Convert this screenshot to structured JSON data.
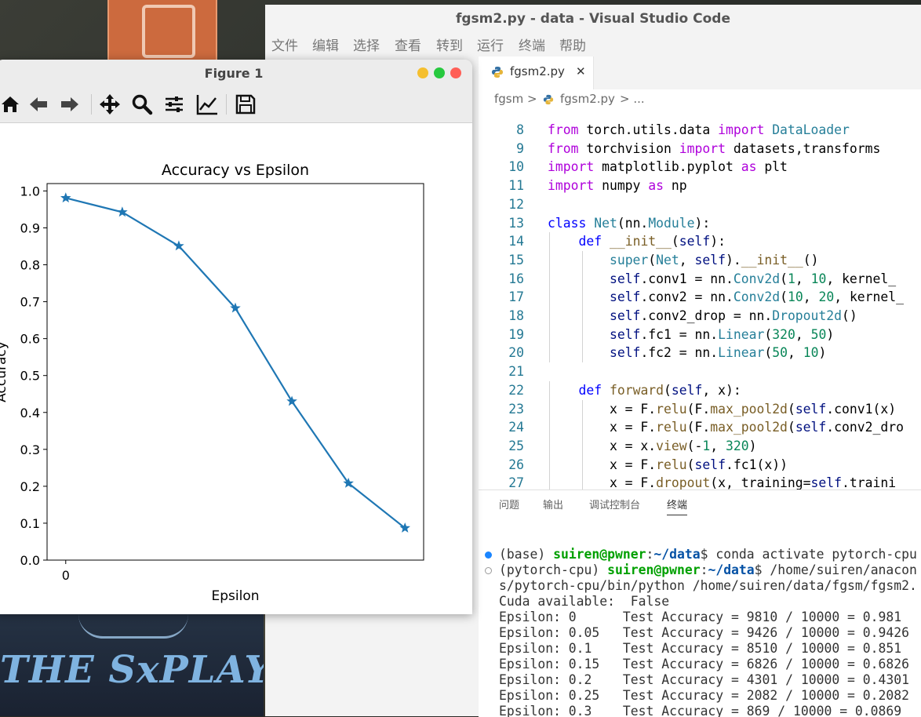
{
  "vscode": {
    "title": "fgsm2.py - data - Visual Studio Code",
    "menu": [
      "文件",
      "编辑",
      "选择",
      "查看",
      "转到",
      "运行",
      "终端",
      "帮助"
    ],
    "tab_label": "fgsm2.py",
    "tab_close": "✕",
    "breadcrumb": [
      "fgsm",
      ">",
      "fgsm2.py",
      "> ..."
    ],
    "panel_tabs": [
      "问题",
      "输出",
      "调试控制台",
      "终端"
    ]
  },
  "code_lines": [
    {
      "n": "8",
      "segs": [
        [
          "kw",
          "from "
        ],
        [
          "tx",
          "torch.utils.data "
        ],
        [
          "kw",
          "import "
        ],
        [
          "cl",
          "DataLoader"
        ]
      ]
    },
    {
      "n": "9",
      "segs": [
        [
          "kw",
          "from "
        ],
        [
          "tx",
          "torchvision "
        ],
        [
          "kw",
          "import "
        ],
        [
          "tx",
          "datasets,transforms"
        ]
      ]
    },
    {
      "n": "10",
      "segs": [
        [
          "kw",
          "import "
        ],
        [
          "tx",
          "matplotlib.pyplot "
        ],
        [
          "kw",
          "as "
        ],
        [
          "tx",
          "plt"
        ]
      ]
    },
    {
      "n": "11",
      "segs": [
        [
          "kw",
          "import "
        ],
        [
          "tx",
          "numpy "
        ],
        [
          "kw",
          "as "
        ],
        [
          "tx",
          "np"
        ]
      ]
    },
    {
      "n": "12",
      "segs": []
    },
    {
      "n": "13",
      "segs": [
        [
          "kb",
          "class "
        ],
        [
          "cl",
          "Net"
        ],
        [
          "tx",
          "(nn."
        ],
        [
          "cl",
          "Module"
        ],
        [
          "tx",
          "):"
        ]
      ]
    },
    {
      "n": "14",
      "segs": [
        [
          "tx",
          "    "
        ],
        [
          "kb",
          "def "
        ],
        [
          "fn",
          "__init__"
        ],
        [
          "tx",
          "("
        ],
        [
          "sf",
          "self"
        ],
        [
          "tx",
          "):"
        ]
      ]
    },
    {
      "n": "15",
      "segs": [
        [
          "tx",
          "        "
        ],
        [
          "cl",
          "super"
        ],
        [
          "tx",
          "("
        ],
        [
          "cl",
          "Net"
        ],
        [
          "tx",
          ", "
        ],
        [
          "sf",
          "self"
        ],
        [
          "tx",
          ")."
        ],
        [
          "fn",
          "__init__"
        ],
        [
          "tx",
          "()"
        ]
      ]
    },
    {
      "n": "16",
      "segs": [
        [
          "tx",
          "        "
        ],
        [
          "sf",
          "self"
        ],
        [
          "tx",
          ".conv1 = nn."
        ],
        [
          "cl",
          "Conv2d"
        ],
        [
          "tx",
          "("
        ],
        [
          "nm",
          "1"
        ],
        [
          "tx",
          ", "
        ],
        [
          "nm",
          "10"
        ],
        [
          "tx",
          ", kernel_"
        ]
      ]
    },
    {
      "n": "17",
      "segs": [
        [
          "tx",
          "        "
        ],
        [
          "sf",
          "self"
        ],
        [
          "tx",
          ".conv2 = nn."
        ],
        [
          "cl",
          "Conv2d"
        ],
        [
          "tx",
          "("
        ],
        [
          "nm",
          "10"
        ],
        [
          "tx",
          ", "
        ],
        [
          "nm",
          "20"
        ],
        [
          "tx",
          ", kernel_"
        ]
      ]
    },
    {
      "n": "18",
      "segs": [
        [
          "tx",
          "        "
        ],
        [
          "sf",
          "self"
        ],
        [
          "tx",
          ".conv2_drop = nn."
        ],
        [
          "cl",
          "Dropout2d"
        ],
        [
          "tx",
          "()"
        ]
      ]
    },
    {
      "n": "19",
      "segs": [
        [
          "tx",
          "        "
        ],
        [
          "sf",
          "self"
        ],
        [
          "tx",
          ".fc1 = nn."
        ],
        [
          "cl",
          "Linear"
        ],
        [
          "tx",
          "("
        ],
        [
          "nm",
          "320"
        ],
        [
          "tx",
          ", "
        ],
        [
          "nm",
          "50"
        ],
        [
          "tx",
          ")"
        ]
      ]
    },
    {
      "n": "20",
      "segs": [
        [
          "tx",
          "        "
        ],
        [
          "sf",
          "self"
        ],
        [
          "tx",
          ".fc2 = nn."
        ],
        [
          "cl",
          "Linear"
        ],
        [
          "tx",
          "("
        ],
        [
          "nm",
          "50"
        ],
        [
          "tx",
          ", "
        ],
        [
          "nm",
          "10"
        ],
        [
          "tx",
          ")"
        ]
      ]
    },
    {
      "n": "21",
      "segs": []
    },
    {
      "n": "22",
      "segs": [
        [
          "tx",
          "    "
        ],
        [
          "kb",
          "def "
        ],
        [
          "fn",
          "forward"
        ],
        [
          "tx",
          "("
        ],
        [
          "sf",
          "self"
        ],
        [
          "tx",
          ", x):"
        ]
      ]
    },
    {
      "n": "23",
      "segs": [
        [
          "tx",
          "        x = F."
        ],
        [
          "fn",
          "relu"
        ],
        [
          "tx",
          "(F."
        ],
        [
          "fn",
          "max_pool2d"
        ],
        [
          "tx",
          "("
        ],
        [
          "sf",
          "self"
        ],
        [
          "tx",
          ".conv1(x)"
        ]
      ]
    },
    {
      "n": "24",
      "segs": [
        [
          "tx",
          "        x = F."
        ],
        [
          "fn",
          "relu"
        ],
        [
          "tx",
          "(F."
        ],
        [
          "fn",
          "max_pool2d"
        ],
        [
          "tx",
          "("
        ],
        [
          "sf",
          "self"
        ],
        [
          "tx",
          ".conv2_dro"
        ]
      ]
    },
    {
      "n": "25",
      "segs": [
        [
          "tx",
          "        x = x."
        ],
        [
          "fn",
          "view"
        ],
        [
          "tx",
          "(-"
        ],
        [
          "nm",
          "1"
        ],
        [
          "tx",
          ", "
        ],
        [
          "nm",
          "320"
        ],
        [
          "tx",
          ")"
        ]
      ]
    },
    {
      "n": "26",
      "segs": [
        [
          "tx",
          "        x = F."
        ],
        [
          "fn",
          "relu"
        ],
        [
          "tx",
          "("
        ],
        [
          "sf",
          "self"
        ],
        [
          "tx",
          ".fc1(x))"
        ]
      ]
    },
    {
      "n": "27",
      "segs": [
        [
          "tx",
          "        x = F."
        ],
        [
          "fn",
          "dropout"
        ],
        [
          "tx",
          "(x, training="
        ],
        [
          "sf",
          "self"
        ],
        [
          "tx",
          ".traini"
        ]
      ]
    }
  ],
  "terminal": {
    "line1": {
      "pre": "(base) ",
      "user": "suiren@pwner",
      "colon": ":",
      "path": "~/data",
      "rest": "$ conda activate pytorch-cpu"
    },
    "line2": {
      "pre": "(pytorch-cpu) ",
      "user": "suiren@pwner",
      "colon": ":",
      "path": "~/data",
      "rest": "$ /home/suiren/anacon"
    },
    "lines": [
      "s/pytorch-cpu/bin/python /home/suiren/data/fgsm/fgsm2.",
      "Cuda available:  False",
      "Epsilon: 0      Test Accuracy = 9810 / 10000 = 0.981",
      "Epsilon: 0.05   Test Accuracy = 9426 / 10000 = 0.9426",
      "Epsilon: 0.1    Test Accuracy = 8510 / 10000 = 0.851",
      "Epsilon: 0.15   Test Accuracy = 6826 / 10000 = 0.6826",
      "Epsilon: 0.2    Test Accuracy = 4301 / 10000 = 0.4301",
      "Epsilon: 0.25   Test Accuracy = 2082 / 10000 = 0.2082",
      "Epsilon: 0.3    Test Accuracy = 869 / 10000 = 0.0869"
    ]
  },
  "figure": {
    "window_title": "Figure 1",
    "toolbar_icons": [
      "home-icon",
      "back-arrow-icon",
      "forward-arrow-icon",
      "pan-move-icon",
      "zoom-magnifier-icon",
      "configure-subplots-icon",
      "edit-axis-icon",
      "save-disk-icon"
    ]
  },
  "chart_data": {
    "type": "line",
    "title": "Accuracy vs Epsilon",
    "xlabel": "Epsilon",
    "ylabel": "Accuracy",
    "x": [
      0,
      0.05,
      0.1,
      0.15,
      0.2,
      0.25,
      0.3
    ],
    "y": [
      0.981,
      0.9426,
      0.851,
      0.6826,
      0.4301,
      0.2082,
      0.0869
    ],
    "marker": "star",
    "color": "#1f77b4",
    "x_ticks": [
      0
    ],
    "x_tick_labels": [
      "0"
    ],
    "y_ticks": [
      0.0,
      0.1,
      0.2,
      0.3,
      0.4,
      0.5,
      0.6,
      0.7,
      0.8,
      0.9,
      1.0
    ],
    "y_tick_labels": [
      "0.0",
      "0.1",
      "0.2",
      "0.3",
      "0.4",
      "0.5",
      "0.6",
      "0.7",
      "0.8",
      "0.9",
      "1.0"
    ],
    "ylim": [
      0.0,
      1.02
    ],
    "grid": false
  },
  "wallpaper": {
    "text": "THE SxPLAY"
  }
}
